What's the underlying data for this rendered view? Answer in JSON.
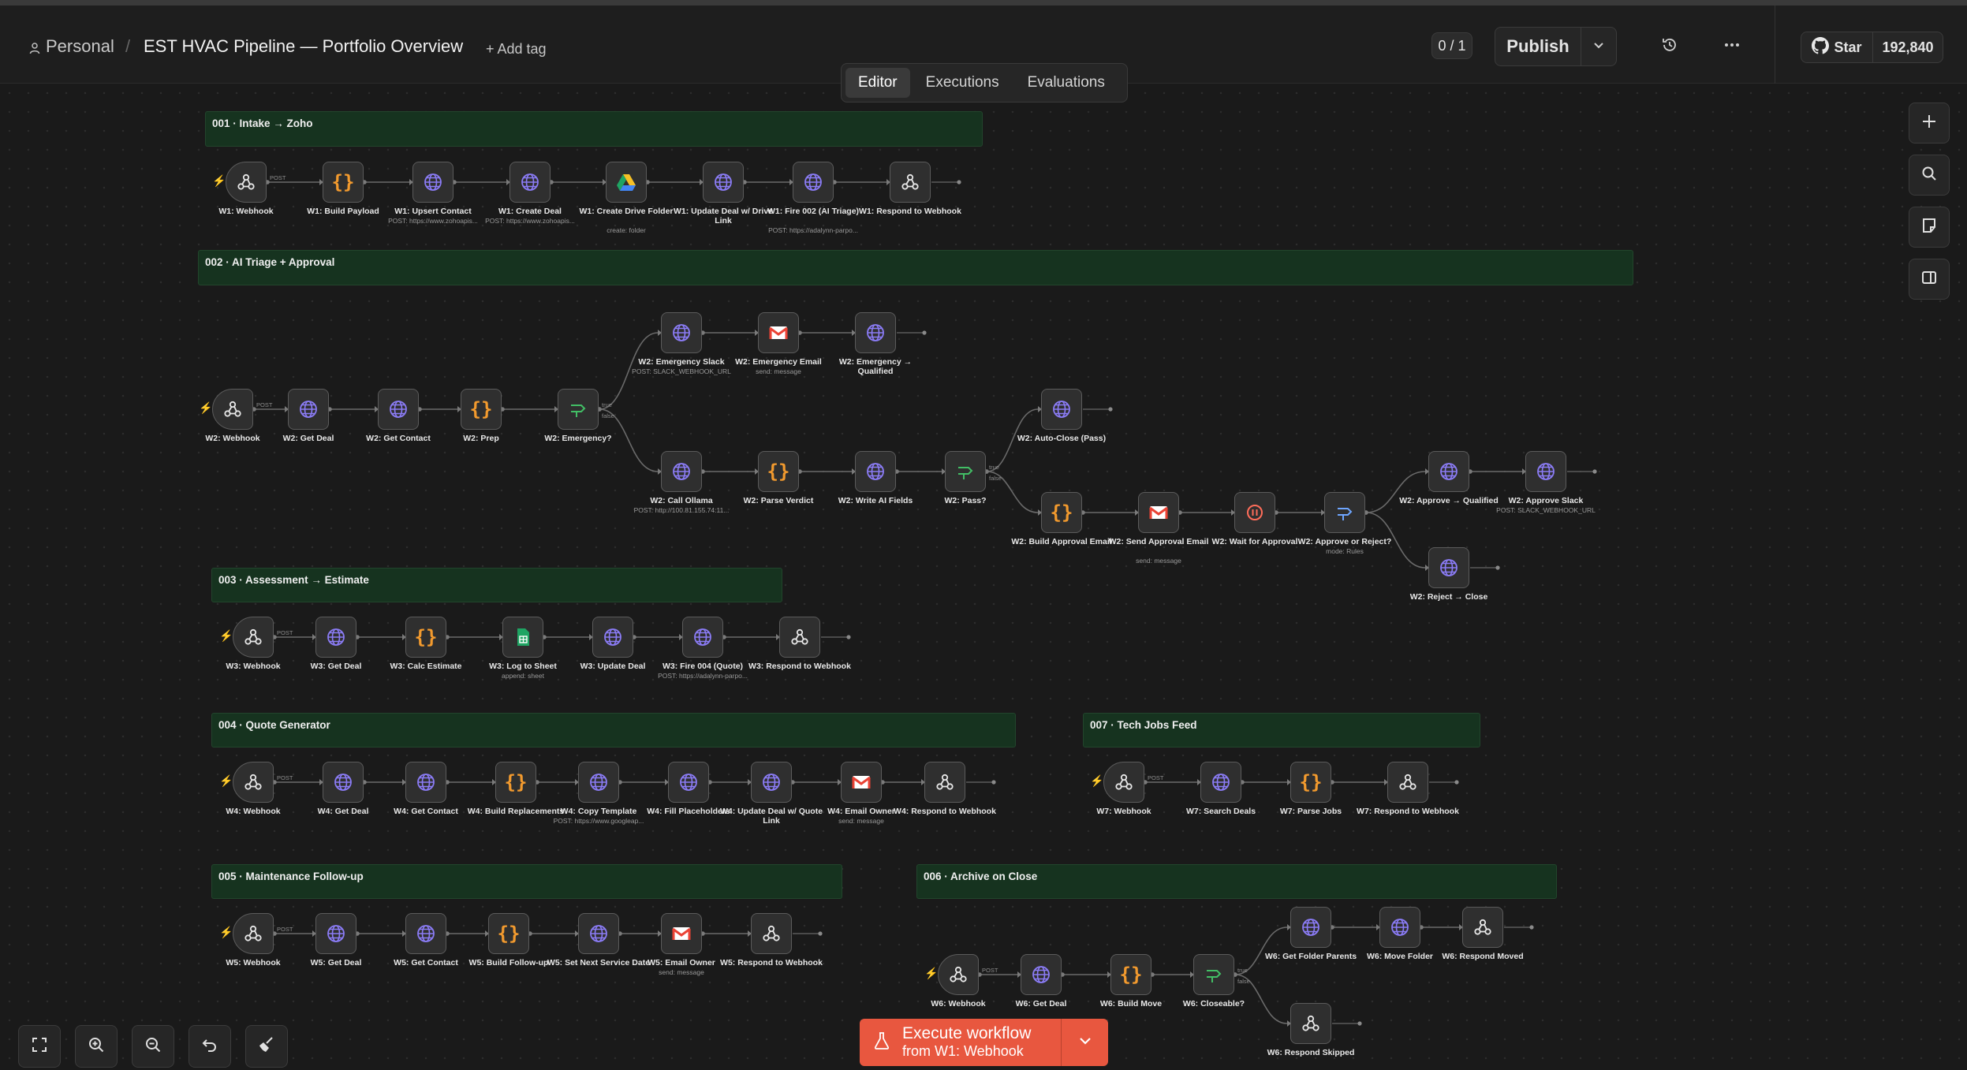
{
  "header": {
    "owner": "Personal",
    "separator": "/",
    "workflow_name": "EST HVAC Pipeline — Portfolio Overview",
    "add_tag": "+ Add tag",
    "counter": "0 / 1",
    "publish_label": "Publish",
    "github_star_label": "Star",
    "github_star_count": "192,840"
  },
  "tabs": [
    {
      "label": "Editor",
      "active": true
    },
    {
      "label": "Executions",
      "active": false
    },
    {
      "label": "Evaluations",
      "active": false
    }
  ],
  "execute": {
    "line1": "Execute workflow",
    "line2": "from W1: Webhook"
  },
  "edge_labels": {
    "post": "POST",
    "true": "true",
    "false": "false"
  },
  "stickies": [
    {
      "title": "001 · Intake → Zoho"
    },
    {
      "title": "002 · AI Triage + Approval"
    },
    {
      "title": "003 · Assessment → Estimate"
    },
    {
      "title": "004 · Quote Generator"
    },
    {
      "title": "007 · Tech Jobs Feed"
    },
    {
      "title": "005 · Maintenance Follow-up"
    },
    {
      "title": "006 · Archive on Close"
    }
  ],
  "nodes": [
    {
      "icon": "webhook",
      "label": "W1: Webhook",
      "sub": "",
      "trigger": true
    },
    {
      "icon": "code",
      "label": "W1: Build Payload",
      "sub": ""
    },
    {
      "icon": "http",
      "label": "W1: Upsert Contact",
      "sub": "POST: https://www.zohoapis..."
    },
    {
      "icon": "http",
      "label": "W1: Create Deal",
      "sub": "POST: https://www.zohoapis..."
    },
    {
      "icon": "drive",
      "label": "W1: Create Drive Folder",
      "sub": "create: folder"
    },
    {
      "icon": "http",
      "label": "W1: Update Deal w/ Drive Link",
      "sub": ""
    },
    {
      "icon": "http",
      "label": "W1: Fire 002 (AI Triage)",
      "sub": "POST: https://adalynn-parpo..."
    },
    {
      "icon": "webhook",
      "label": "W1: Respond to Webhook",
      "sub": ""
    },
    {
      "icon": "webhook",
      "label": "W2: Webhook",
      "sub": "",
      "trigger": true
    },
    {
      "icon": "http",
      "label": "W2: Get Deal",
      "sub": ""
    },
    {
      "icon": "http",
      "label": "W2: Get Contact",
      "sub": ""
    },
    {
      "icon": "code",
      "label": "W2: Prep",
      "sub": ""
    },
    {
      "icon": "if",
      "label": "W2: Emergency?",
      "sub": ""
    },
    {
      "icon": "http",
      "label": "W2: Emergency Slack",
      "sub": "POST: SLACK_WEBHOOK_URL"
    },
    {
      "icon": "gmail",
      "label": "W2: Emergency Email",
      "sub": "send: message"
    },
    {
      "icon": "http",
      "label": "W2: Emergency → Qualified",
      "sub": ""
    },
    {
      "icon": "http",
      "label": "W2: Call Ollama",
      "sub": "POST: http://100.81.155.74:11..."
    },
    {
      "icon": "code",
      "label": "W2: Parse Verdict",
      "sub": ""
    },
    {
      "icon": "http",
      "label": "W2: Write AI Fields",
      "sub": ""
    },
    {
      "icon": "if",
      "label": "W2: Pass?",
      "sub": ""
    },
    {
      "icon": "http",
      "label": "W2: Auto-Close (Pass)",
      "sub": ""
    },
    {
      "icon": "code",
      "label": "W2: Build Approval Email",
      "sub": ""
    },
    {
      "icon": "gmail",
      "label": "W2: Send Approval Email",
      "sub": "send: message"
    },
    {
      "icon": "wait",
      "label": "W2: Wait for Approval",
      "sub": ""
    },
    {
      "icon": "switch",
      "label": "W2: Approve or Reject?",
      "sub": "mode: Rules"
    },
    {
      "icon": "http",
      "label": "W2: Approve → Qualified",
      "sub": ""
    },
    {
      "icon": "http",
      "label": "W2: Approve Slack",
      "sub": "POST: SLACK_WEBHOOK_URL"
    },
    {
      "icon": "http",
      "label": "W2: Reject → Close",
      "sub": ""
    },
    {
      "icon": "webhook",
      "label": "W3: Webhook",
      "sub": "",
      "trigger": true
    },
    {
      "icon": "http",
      "label": "W3: Get Deal",
      "sub": ""
    },
    {
      "icon": "code",
      "label": "W3: Calc Estimate",
      "sub": ""
    },
    {
      "icon": "sheets",
      "label": "W3: Log to Sheet",
      "sub": "append: sheet"
    },
    {
      "icon": "http",
      "label": "W3: Update Deal",
      "sub": ""
    },
    {
      "icon": "http",
      "label": "W3: Fire 004 (Quote)",
      "sub": "POST: https://adalynn-parpo..."
    },
    {
      "icon": "webhook",
      "label": "W3: Respond to Webhook",
      "sub": ""
    },
    {
      "icon": "webhook",
      "label": "W4: Webhook",
      "sub": "",
      "trigger": true
    },
    {
      "icon": "http",
      "label": "W4: Get Deal",
      "sub": ""
    },
    {
      "icon": "http",
      "label": "W4: Get Contact",
      "sub": ""
    },
    {
      "icon": "code",
      "label": "W4: Build Replacements",
      "sub": ""
    },
    {
      "icon": "http",
      "label": "W4: Copy Template",
      "sub": "POST: https://www.googleap..."
    },
    {
      "icon": "http",
      "label": "W4: Fill Placeholders",
      "sub": ""
    },
    {
      "icon": "http",
      "label": "W4: Update Deal w/ Quote Link",
      "sub": ""
    },
    {
      "icon": "gmail",
      "label": "W4: Email Owner",
      "sub": "send: message"
    },
    {
      "icon": "webhook",
      "label": "W4: Respond to Webhook",
      "sub": ""
    },
    {
      "icon": "webhook",
      "label": "W7: Webhook",
      "sub": "",
      "trigger": true
    },
    {
      "icon": "http",
      "label": "W7: Search Deals",
      "sub": ""
    },
    {
      "icon": "code",
      "label": "W7: Parse Jobs",
      "sub": ""
    },
    {
      "icon": "webhook",
      "label": "W7: Respond to Webhook",
      "sub": ""
    },
    {
      "icon": "webhook",
      "label": "W5: Webhook",
      "sub": "",
      "trigger": true
    },
    {
      "icon": "http",
      "label": "W5: Get Deal",
      "sub": ""
    },
    {
      "icon": "http",
      "label": "W5: Get Contact",
      "sub": ""
    },
    {
      "icon": "code",
      "label": "W5: Build Follow-up",
      "sub": ""
    },
    {
      "icon": "http",
      "label": "W5: Set Next Service Date",
      "sub": ""
    },
    {
      "icon": "gmail",
      "label": "W5: Email Owner",
      "sub": "send: message"
    },
    {
      "icon": "webhook",
      "label": "W5: Respond to Webhook",
      "sub": ""
    },
    {
      "icon": "webhook",
      "label": "W6: Webhook",
      "sub": "",
      "trigger": true
    },
    {
      "icon": "http",
      "label": "W6: Get Deal",
      "sub": ""
    },
    {
      "icon": "code",
      "label": "W6: Build Move",
      "sub": ""
    },
    {
      "icon": "if",
      "label": "W6: Closeable?",
      "sub": ""
    },
    {
      "icon": "http",
      "label": "W6: Get Folder Parents",
      "sub": ""
    },
    {
      "icon": "http",
      "label": "W6: Move Folder",
      "sub": ""
    },
    {
      "icon": "webhook",
      "label": "W6: Respond Moved",
      "sub": ""
    },
    {
      "icon": "webhook",
      "label": "W6: Respond Skipped",
      "sub": ""
    }
  ],
  "edges": [
    [
      0,
      1,
      "post"
    ],
    [
      1,
      2
    ],
    [
      2,
      3
    ],
    [
      3,
      4
    ],
    [
      4,
      5
    ],
    [
      5,
      6
    ],
    [
      6,
      7
    ],
    [
      8,
      9,
      "post"
    ],
    [
      9,
      10
    ],
    [
      10,
      11
    ],
    [
      11,
      12
    ],
    [
      12,
      13,
      "true"
    ],
    [
      12,
      16,
      "false"
    ],
    [
      13,
      14
    ],
    [
      14,
      15
    ],
    [
      16,
      17
    ],
    [
      17,
      18
    ],
    [
      18,
      19
    ],
    [
      19,
      20,
      "true"
    ],
    [
      19,
      21,
      "false"
    ],
    [
      21,
      22
    ],
    [
      22,
      23
    ],
    [
      23,
      24
    ],
    [
      24,
      25
    ],
    [
      25,
      26
    ],
    [
      24,
      27
    ],
    [
      28,
      29,
      "post"
    ],
    [
      29,
      30
    ],
    [
      30,
      31
    ],
    [
      31,
      32
    ],
    [
      32,
      33
    ],
    [
      33,
      34
    ],
    [
      35,
      36,
      "post"
    ],
    [
      36,
      37
    ],
    [
      37,
      38
    ],
    [
      38,
      39
    ],
    [
      39,
      40
    ],
    [
      40,
      41
    ],
    [
      41,
      42
    ],
    [
      42,
      43
    ],
    [
      44,
      45,
      "post"
    ],
    [
      45,
      46
    ],
    [
      46,
      47
    ],
    [
      48,
      49,
      "post"
    ],
    [
      49,
      50
    ],
    [
      50,
      51
    ],
    [
      51,
      52
    ],
    [
      52,
      53
    ],
    [
      53,
      54
    ],
    [
      55,
      56,
      "post"
    ],
    [
      56,
      57
    ],
    [
      57,
      58
    ],
    [
      58,
      59,
      "true"
    ],
    [
      58,
      62,
      "false"
    ],
    [
      59,
      60
    ],
    [
      60,
      61
    ]
  ],
  "end_stubs": [
    7,
    15,
    20,
    26,
    27,
    34,
    43,
    47,
    54,
    61,
    62
  ]
}
